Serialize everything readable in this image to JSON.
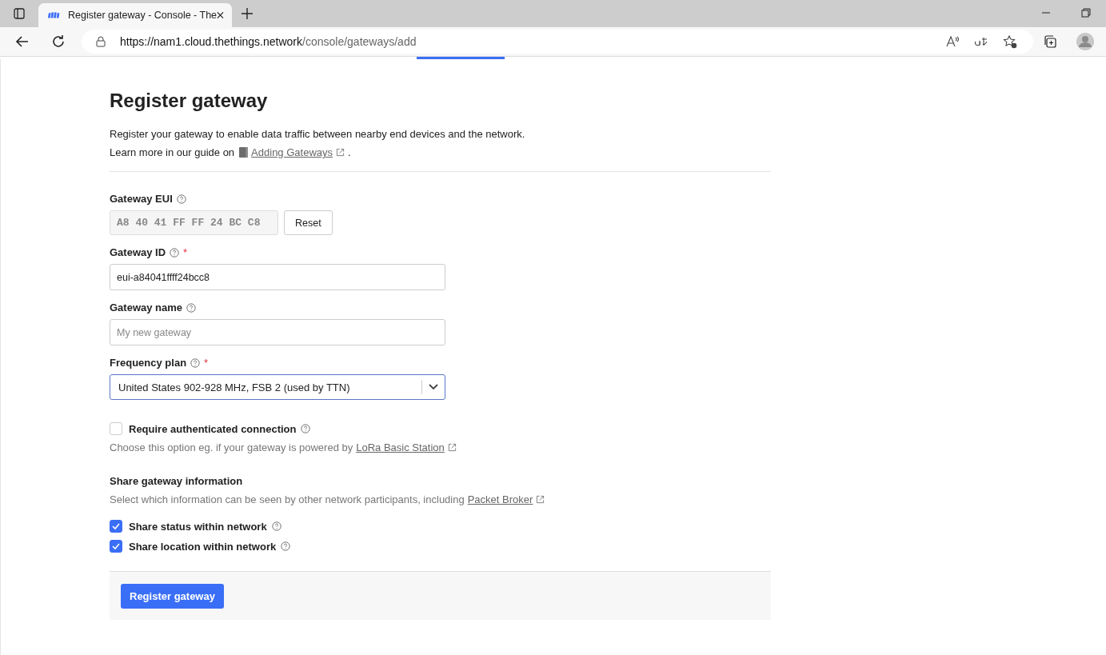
{
  "browser": {
    "tab_title": "Register gateway - Console - The",
    "url_host": "https://nam1.cloud.thethings.network",
    "url_path": "/console/gateways/add"
  },
  "page": {
    "title": "Register gateway",
    "intro": "Register your gateway to enable data traffic between nearby end devices and the network.",
    "guide_prefix": "Learn more in our guide on",
    "guide_link": "Adding Gateways",
    "guide_suffix": "."
  },
  "fields": [
    {
      "kind": "eui",
      "label": "Gateway EUI",
      "value": "A8 40 41 FF FF 24 BC C8",
      "button": "Reset"
    },
    {
      "kind": "text",
      "label": "Gateway ID",
      "required_mark": "*",
      "value": "eui-a84041ffff24bcc8"
    },
    {
      "kind": "text",
      "label": "Gateway name",
      "placeholder": "My new gateway"
    },
    {
      "kind": "select",
      "label": "Frequency plan",
      "required_mark": "*",
      "value": "United States 902-928 MHz, FSB 2 (used by TTN)"
    }
  ],
  "auth": {
    "label": "Require authenticated connection",
    "checked": false,
    "hint": "Choose this option eg. if your gateway is powered by",
    "link": "LoRa Basic Station"
  },
  "share": {
    "heading": "Share gateway information",
    "hint": "Select which information can be seen by other network participants, including",
    "link": "Packet Broker",
    "options": [
      {
        "label": "Share status within network",
        "checked": true
      },
      {
        "label": "Share location within network",
        "checked": true
      }
    ]
  },
  "submit": "Register gateway"
}
